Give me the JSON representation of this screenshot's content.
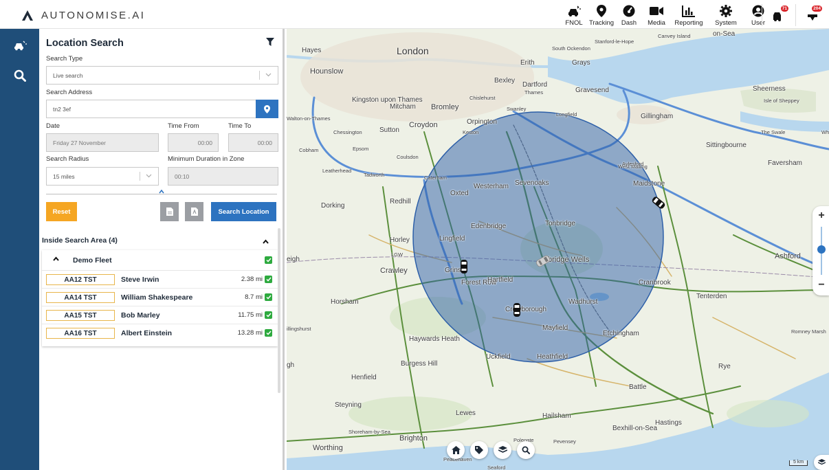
{
  "app": {
    "logo_text": "AUTONOMISE.AI"
  },
  "nav": [
    {
      "label": "FNOL",
      "icon": "car-crash-icon"
    },
    {
      "label": "Tracking",
      "icon": "map-pin-icon"
    },
    {
      "label": "Dash",
      "icon": "dashboard-icon"
    },
    {
      "label": "Media",
      "icon": "video-icon"
    },
    {
      "label": "Reporting",
      "icon": "bar-chart-icon"
    },
    {
      "label": "System",
      "icon": "gear-icon"
    },
    {
      "label": "User",
      "icon": "user-icon"
    }
  ],
  "alerts": [
    {
      "badge": "71",
      "icon": "vehicle-alert-icon"
    },
    {
      "badge": "204",
      "icon": "notification-alert-icon"
    }
  ],
  "panel": {
    "title": "Location Search",
    "search_type_label": "Search Type",
    "search_type_value": "Live search",
    "address_label": "Search Address",
    "address_value": "tn2 3ef",
    "date_label": "Date",
    "date_value": "Friday 27 November",
    "time_from_label": "Time From",
    "time_from_value": "00:00",
    "time_to_label": "Time To",
    "time_to_value": "00:00",
    "radius_label": "Search Radius",
    "radius_value": "15 miles",
    "min_duration_label": "Minimum Duration in Zone",
    "min_duration_value": "00:10",
    "reset_label": "Reset",
    "search_label": "Search Location",
    "inside_title": "Inside Search Area (4)",
    "fleet_name": "Demo Fleet",
    "vehicles": [
      {
        "plate": "AA12 TST",
        "driver": "Steve Irwin",
        "distance": "2.38 mi"
      },
      {
        "plate": "AA14 TST",
        "driver": "William Shakespeare",
        "distance": "8.7 mi"
      },
      {
        "plate": "AA15 TST",
        "driver": "Bob Marley",
        "distance": "11.75 mi"
      },
      {
        "plate": "AA16 TST",
        "driver": "Albert Einstein",
        "distance": "13.28 mi"
      }
    ]
  },
  "map": {
    "places": {
      "london": "London",
      "hayes": "Hayes",
      "hounslow": "Hounslow",
      "kingston": "Kingston upon Thames",
      "mitcham": "Mitcham",
      "bromley": "Bromley",
      "croydon": "Croydon",
      "sutton": "Sutton",
      "orpington": "Orpington",
      "bexley": "Bexley",
      "dartford": "Dartford",
      "erith": "Erith",
      "grays": "Grays",
      "gravesend": "Gravesend",
      "gillingham": "Gillingham",
      "sheerness": "Sheerness",
      "sittingbourne": "Sittingbourne",
      "faversham": "Faversham",
      "maidstone": "Maidstone",
      "sevenoaks": "Sevenoaks",
      "westerham": "Westerham",
      "oxted": "Oxted",
      "redhill": "Redhill",
      "dorking": "Dorking",
      "edenbridge": "Edenbridge",
      "tonbridge": "Tonbridge",
      "tunbridge": "bridge Wells",
      "lingfield": "Lingfield",
      "crawley": "Crawley",
      "horley": "Horley",
      "horsham": "Horsham",
      "forest_row": "Forest Row",
      "hartfield": "Hartfield",
      "crowborough": "Crowborough",
      "wadhurst": "Wadhurst",
      "cranbrook": "Cranbrook",
      "mayfield": "Mayfield",
      "etchingham": "Etchingham",
      "heathfield": "Heathfield",
      "uckfield": "Uckfield",
      "haywards": "Haywards Heath",
      "burgess": "Burgess Hill",
      "henfield": "Henfield",
      "steyning": "Steyning",
      "lewes": "Lewes",
      "brighton": "Brighton",
      "worthing": "Worthing",
      "hailsham": "Hailsham",
      "battle": "Battle",
      "hastings": "Hastings",
      "bexhill": "Bexhill-on-Sea",
      "rye": "Rye",
      "tenterden": "Tenterden",
      "ashford": "Ashford",
      "romney": "Romney Marsh",
      "polegate": "Polegate",
      "pevensey": "Pevensey",
      "shoreham": "Shoreham-by-Sea",
      "peacehaven": "Peacehaven",
      "seaford": "Seaford",
      "epsom": "Epsom",
      "leatherhead": "Leatherhead",
      "tadworth": "Tadworth",
      "caterham": "Caterham",
      "coulsdon": "Coulsdon",
      "chessington": "Chessington",
      "cobham": "Cobham",
      "walton": "Walton-on-Thames",
      "keston": "Keston",
      "swanley": "Swanley",
      "longfield": "Longfield",
      "chislehurst": "Chislehurst",
      "west_malling": "West Malling",
      "aylesford": "Aylesford",
      "stanford": "Stanford-le-Hope",
      "south_ockendon": "South Ockendon",
      "canvey": "Canvey Island",
      "isle_sheppey": "Isle of Sheppey",
      "on_sea": "on-Sea",
      "whits": "Whits",
      "the_swale": "The Swale",
      "thames": "Thames",
      "grins": "Grins",
      "lgw": "LGW",
      "eigh": "eigh",
      "illingshurst": "illingshurst",
      "gh": "gh"
    },
    "scale_label": "5 km",
    "search_radius_miles": 15
  },
  "colors": {
    "primary": "#2d73c0",
    "rail": "#1f4e79",
    "reset": "#f5a623",
    "check": "#2eaa3f",
    "circle": "#2d5fa8"
  }
}
